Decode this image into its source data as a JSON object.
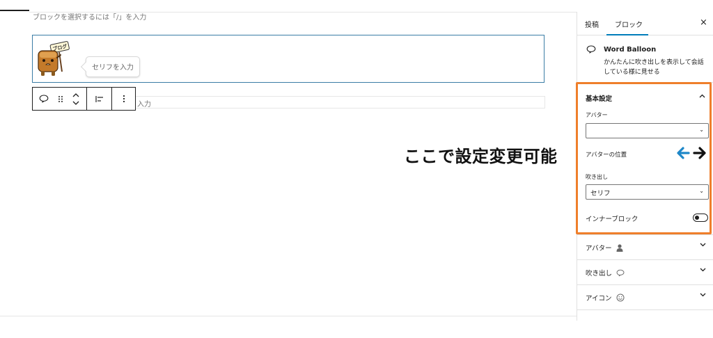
{
  "editor": {
    "block_hint": "ブロックを選択するには「/」を入力",
    "balloon_placeholder": "セリフを入力",
    "mascot_sign_text": "ブログ",
    "inner_block_placeholder": "入力"
  },
  "annotation": {
    "text": "ここで設定変更可能",
    "arrow_left_color": "#1e87c8",
    "arrow_right_color": "#111111"
  },
  "sidebar": {
    "tabs": [
      {
        "label": "投稿",
        "active": false
      },
      {
        "label": "ブロック",
        "active": true
      }
    ],
    "close_label": "×",
    "block_card": {
      "title": "Word Balloon",
      "description": "かんたんに吹き出しを表示して会話している様に見せる"
    },
    "basic_settings": {
      "title": "基本設定",
      "avatar_label": "アバター",
      "avatar_value": "",
      "avatar_position_label": "アバターの位置",
      "balloon_label": "吹き出し",
      "balloon_value": "セリフ",
      "inner_block_label": "インナーブロック",
      "inner_block_enabled": false
    },
    "collapsed_panels": [
      {
        "label": "アバター",
        "icon": "person-icon"
      },
      {
        "label": "吹き出し",
        "icon": "speech-bubble-icon"
      },
      {
        "label": "アイコン",
        "icon": "smiley-icon"
      }
    ]
  },
  "colors": {
    "accent": "#007cba",
    "highlight": "#ef7f2b",
    "block_border": "#3a7ca5"
  }
}
